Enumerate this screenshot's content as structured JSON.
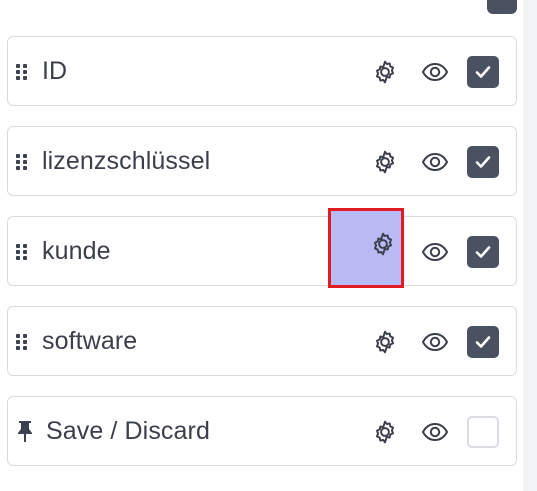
{
  "columns": [
    {
      "label": "ID",
      "handle": "drag-handle-icon",
      "visible": true,
      "checked": true
    },
    {
      "label": "lizenzschlüssel",
      "handle": "drag-handle-icon",
      "visible": true,
      "checked": true
    },
    {
      "label": "kunde",
      "handle": "drag-handle-icon",
      "visible": true,
      "checked": true,
      "highlighted": true
    },
    {
      "label": "software",
      "handle": "drag-handle-icon",
      "visible": true,
      "checked": true
    },
    {
      "label": "Save / Discard",
      "handle": "pin-icon",
      "visible": true,
      "checked": false
    }
  ],
  "colors": {
    "text": "#3a3f4b",
    "border": "#d9dce2",
    "checkbox_on": "#4a5262",
    "highlight_fill": "#b9b9f4",
    "highlight_border": "#e01b22"
  }
}
